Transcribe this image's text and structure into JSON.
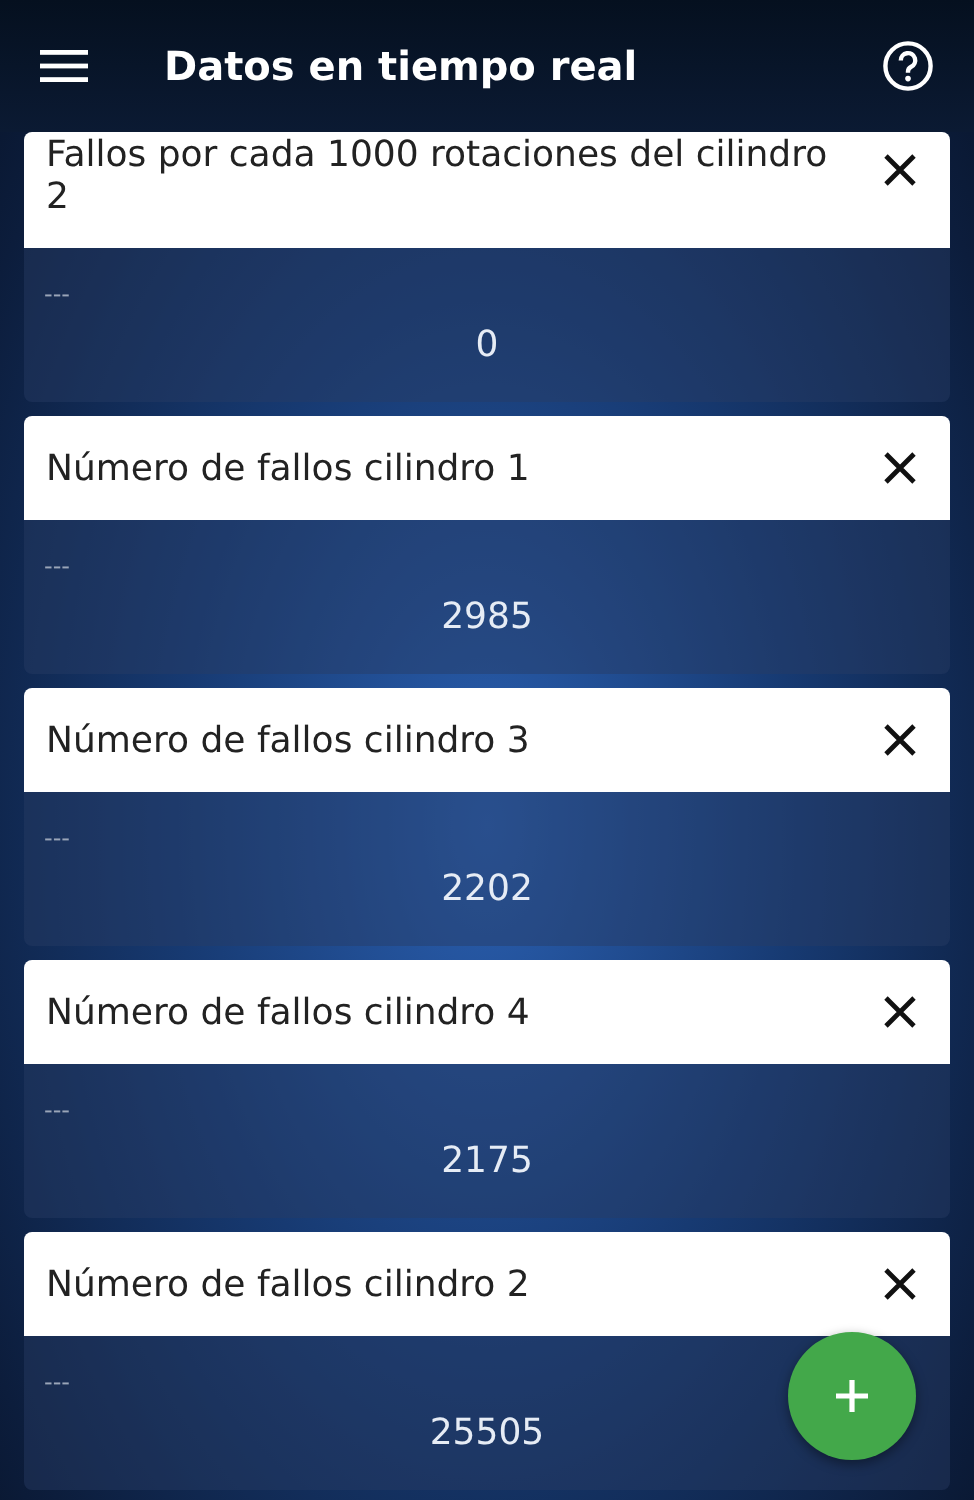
{
  "app_bar": {
    "title": "Datos en tiempo real"
  },
  "cards": [
    {
      "title": "Fallos por cada 1000 rotaciones del cilindro 2",
      "subtitle": "---",
      "value": "0"
    },
    {
      "title": "Número de fallos cilindro 1",
      "subtitle": "---",
      "value": "2985"
    },
    {
      "title": "Número de fallos cilindro 3",
      "subtitle": "---",
      "value": "2202"
    },
    {
      "title": "Número de fallos cilindro 4",
      "subtitle": "---",
      "value": "2175"
    },
    {
      "title": "Número de fallos cilindro 2",
      "subtitle": "---",
      "value": "25505"
    }
  ]
}
